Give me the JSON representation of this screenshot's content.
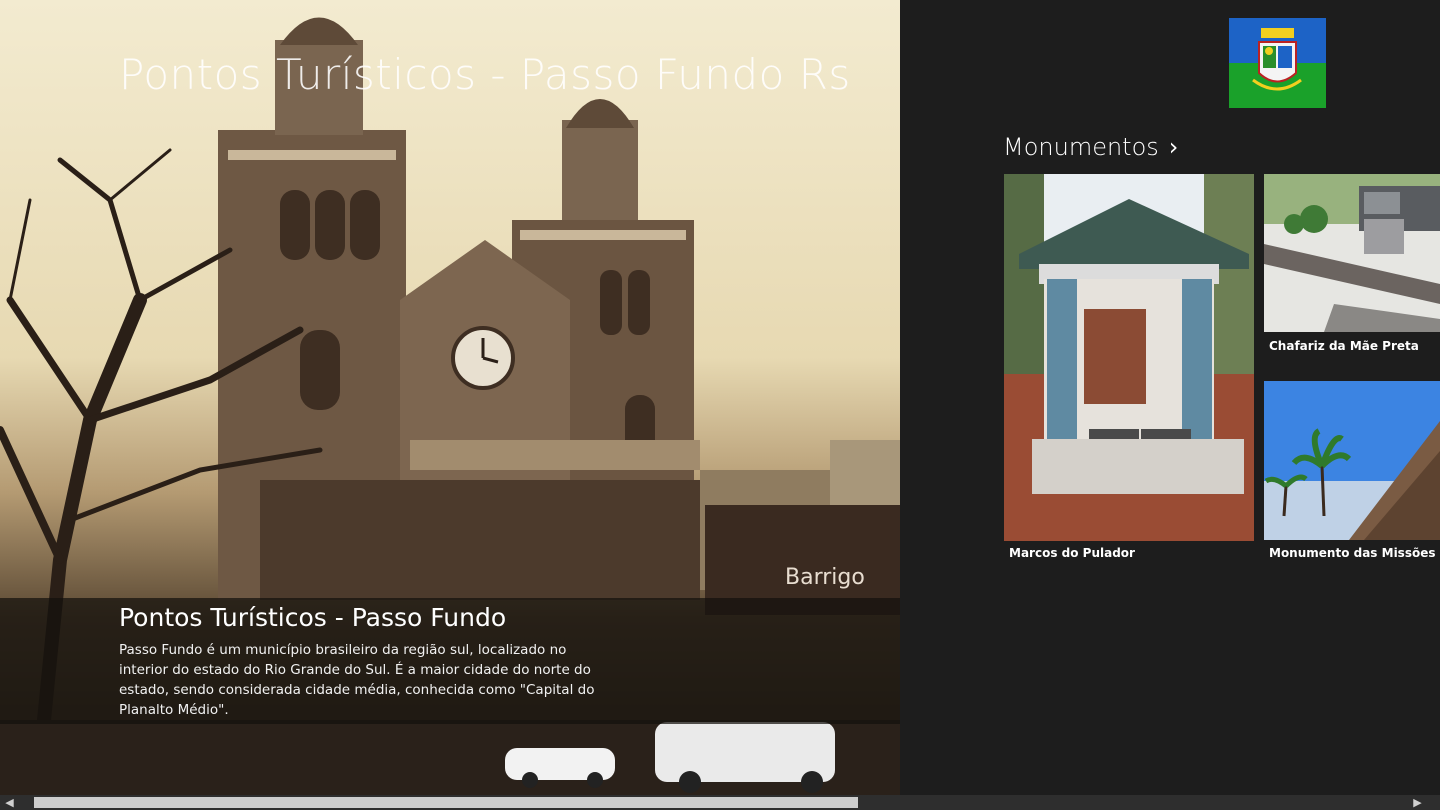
{
  "app": {
    "title": "Pontos Turísticos - Passo Fundo Rs"
  },
  "hero": {
    "overlay_title": "Pontos Turísticos - Passo Fundo",
    "overlay_description": "Passo Fundo é um município brasileiro da região sul, localizado no interior do estado do Rio Grande do Sul. É a maior cidade do norte do estado, sendo considerada cidade média,  conhecida como \"Capital do Planalto Médio\".",
    "storefront_sign": "Barrigo"
  },
  "section": {
    "title": "Monumentos",
    "chevron_icon": "chevron-right-icon"
  },
  "tiles": [
    {
      "label": "Marcos do Pulador"
    },
    {
      "label": "Chafariz da Mãe Preta"
    },
    {
      "label": "Monumento das Missões"
    }
  ],
  "logo": {
    "icon": "coat-of-arms-icon",
    "colors": {
      "top": "#1d63c6",
      "bottom": "#1aa12a"
    }
  },
  "colors": {
    "background": "#1d1d1d",
    "hero_tint": "#e7d9b2"
  }
}
